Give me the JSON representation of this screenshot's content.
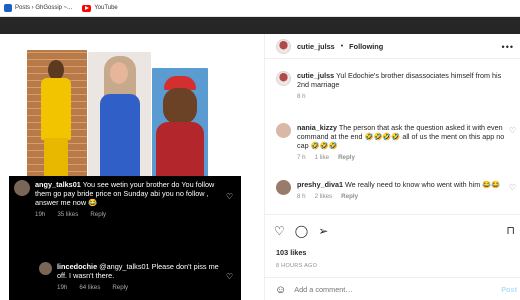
{
  "bookmarks": [
    {
      "label": "Posts › GhGossip ~..."
    },
    {
      "label": "YouTube"
    }
  ],
  "media": {
    "dm": {
      "msg1": {
        "user": "angy_talks01",
        "text": "You see wetin your brother do You follow them go pay bride price on Sunday abi you no follow , answer me now",
        "emoji": "😂",
        "time": "19h",
        "likes": "35 likes",
        "reply": "Reply"
      },
      "msg2": {
        "user": "lincedochie",
        "text": "@angy_talks01 Please don't piss me off. I wasn't there.",
        "time": "19h",
        "likes": "64 likes",
        "reply": "Reply"
      }
    }
  },
  "header": {
    "username": "cutie_julss",
    "separator": "•",
    "follow": "Following",
    "more": "•••"
  },
  "caption": {
    "user": "cutie_julss",
    "text": "Yul Edochie's brother disassociates himself from his 2nd marriage",
    "time": "8 h"
  },
  "comments": [
    {
      "user": "nania_kizzy",
      "text": "The person that ask the question asked it with even command at the end 🤣🤣🤣🤣 all of us the ment on this app no cap 🤣🤣🤣",
      "time": "7 h",
      "likes": "1 like",
      "reply": "Reply",
      "avatar_color": "#d9b8a8"
    },
    {
      "user": "preshy_diva1",
      "text": "We really need to know who went with him 😂😂",
      "time": "8 h",
      "likes": "2 likes",
      "reply": "Reply",
      "avatar_color": "#9a7a6a"
    }
  ],
  "actions": {
    "likes": "103 likes",
    "ago": "8 HOURS AGO",
    "add_placeholder": "Add a comment…",
    "post": "Post"
  },
  "icons": [
    "heart-icon",
    "comment-icon",
    "share-icon",
    "bookmark-icon",
    "smile-icon",
    "more-icon"
  ]
}
